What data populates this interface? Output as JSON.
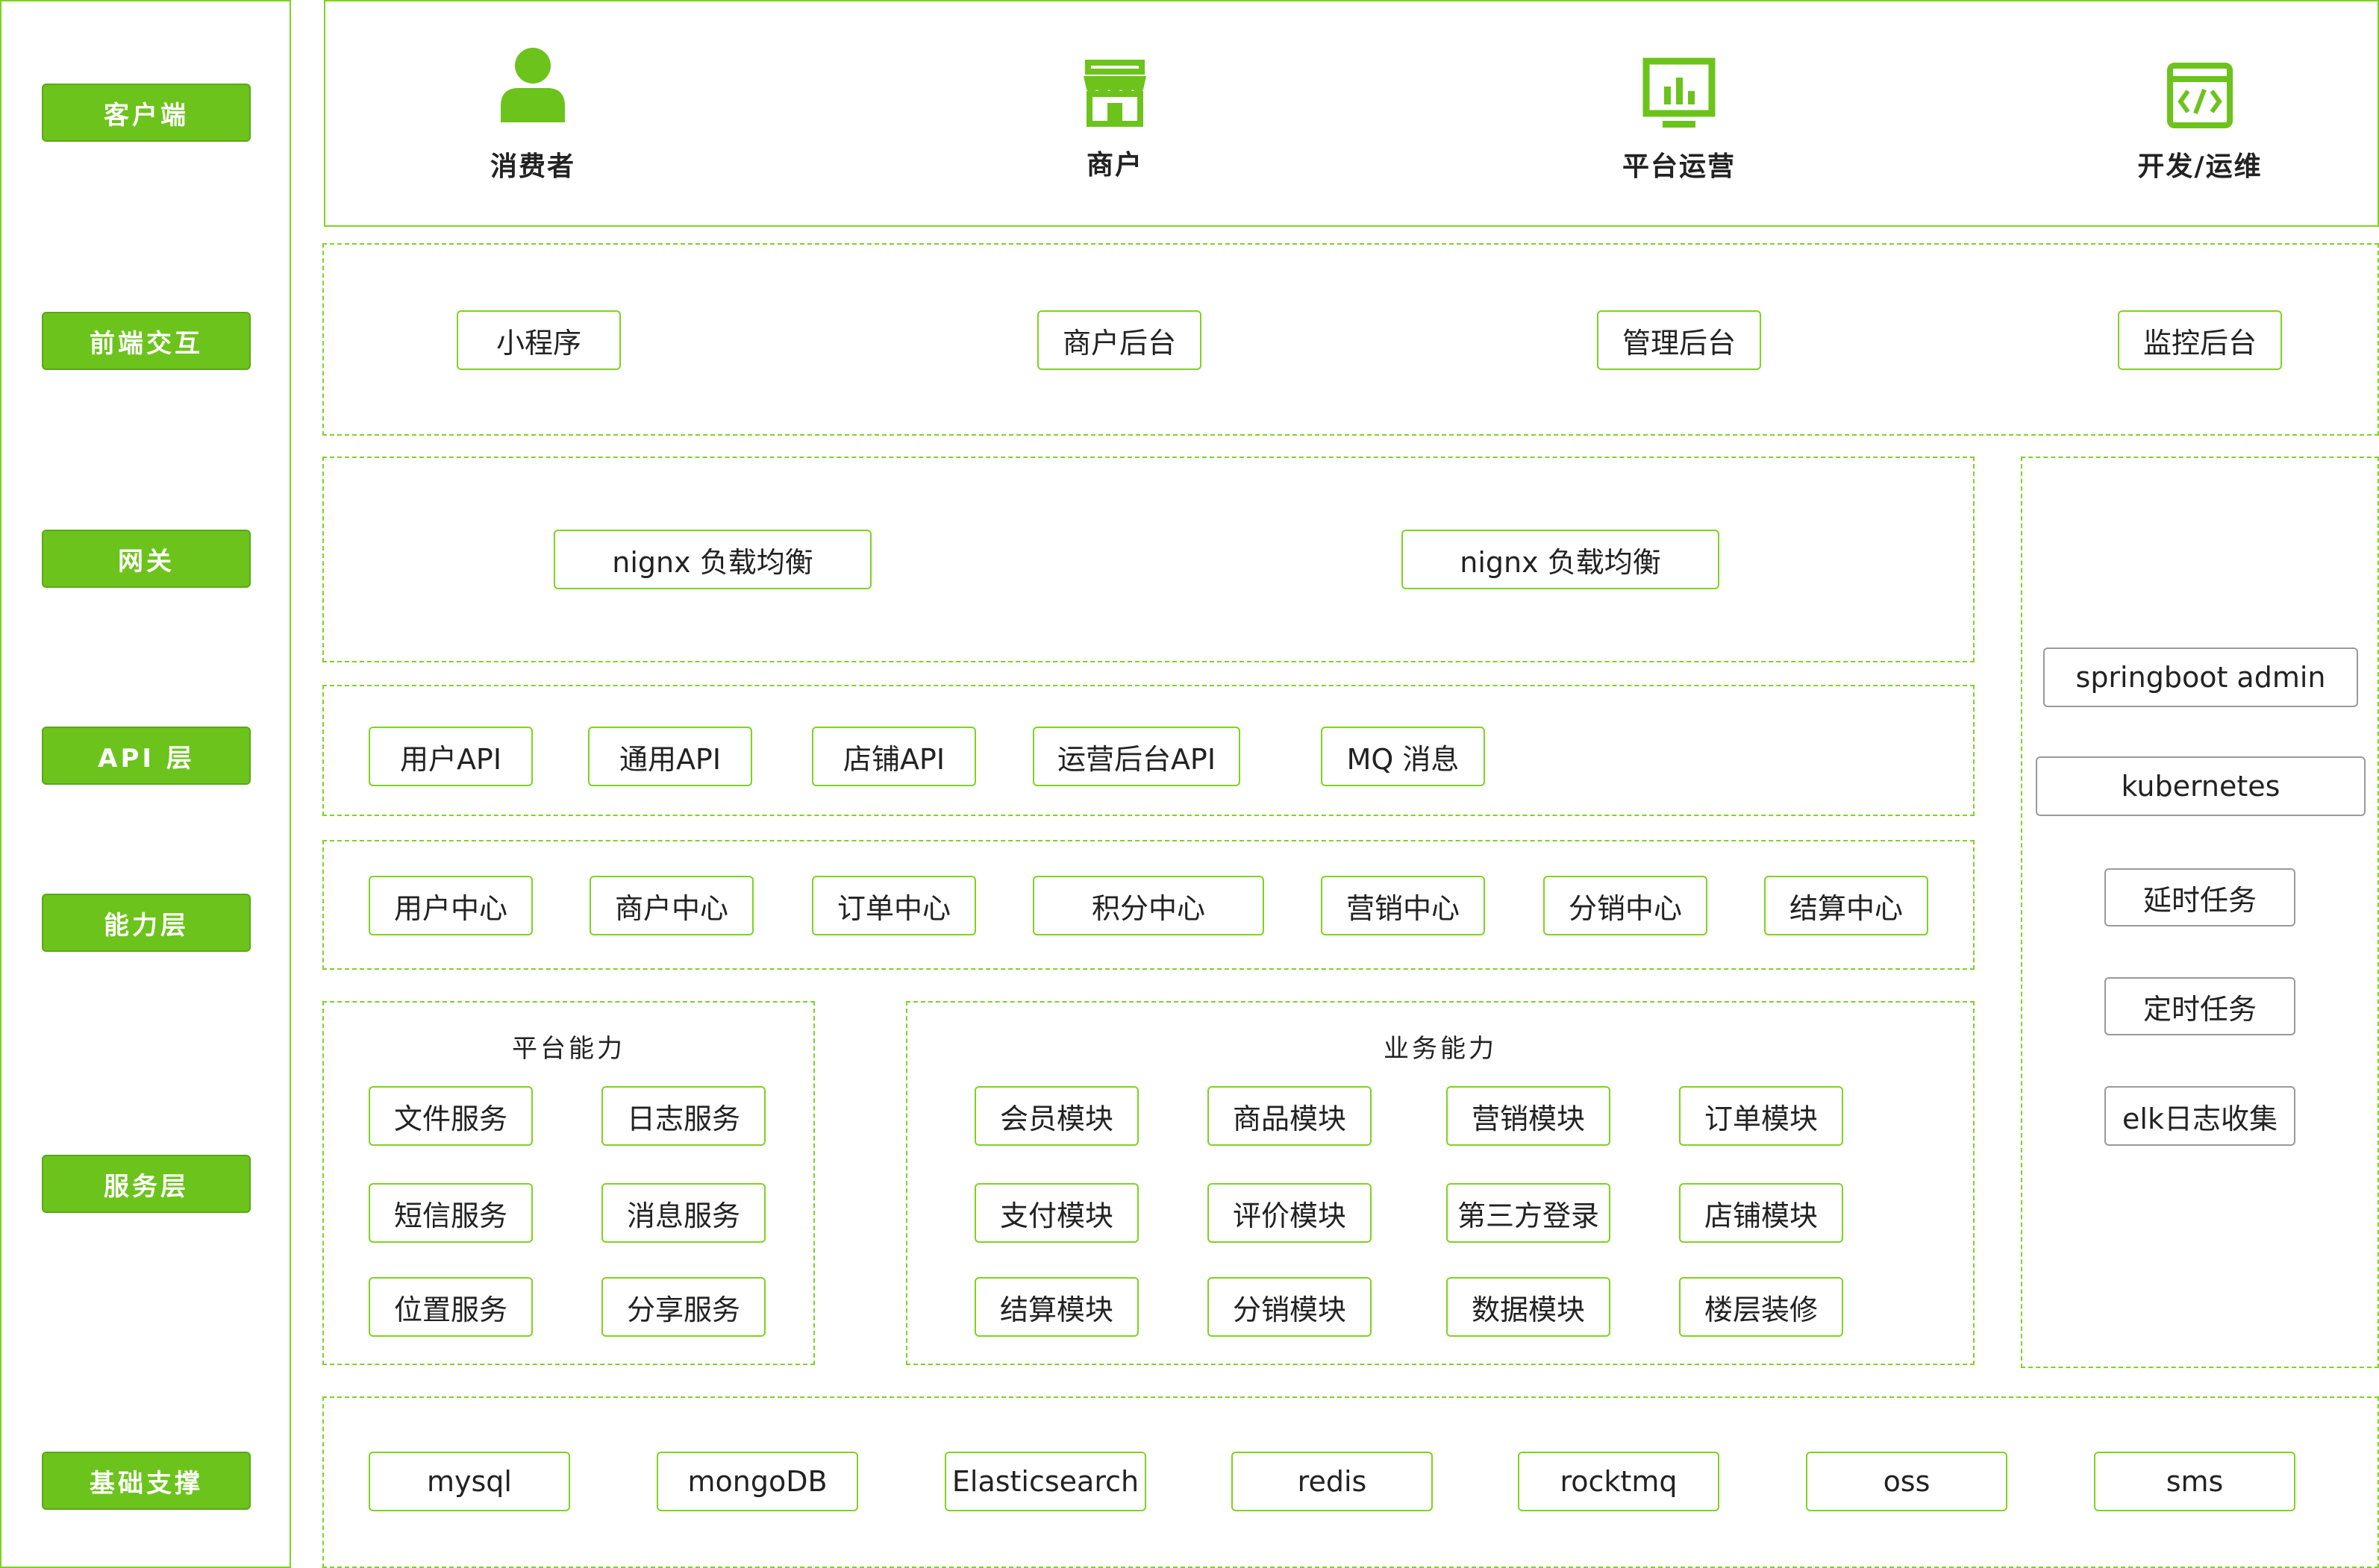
{
  "colors": {
    "accent": "#6cc31c",
    "border": "#7ed321",
    "gray_border": "#9a9a9a"
  },
  "layers": [
    "客户端",
    "前端交互",
    "网关",
    "API 层",
    "能力层",
    "服务层",
    "基础支撑"
  ],
  "clients": [
    {
      "label": "消费者",
      "icon": "user-icon"
    },
    {
      "label": "商户",
      "icon": "store-icon"
    },
    {
      "label": "平台运营",
      "icon": "chart-monitor-icon"
    },
    {
      "label": "开发/运维",
      "icon": "code-window-icon"
    }
  ],
  "frontend": [
    "小程序",
    "商户后台",
    "管理后台",
    "监控后台"
  ],
  "gateway": [
    "nignx 负载均衡",
    "nignx 负载均衡"
  ],
  "api": [
    "用户API",
    "通用API",
    "店铺API",
    "运营后台API",
    "MQ 消息"
  ],
  "capability": [
    "用户中心",
    "商户中心",
    "订单中心",
    "积分中心",
    "营销中心",
    "分销中心",
    "结算中心"
  ],
  "platform": {
    "title": "平台能力",
    "items": [
      "文件服务",
      "日志服务",
      "短信服务",
      "消息服务",
      "位置服务",
      "分享服务"
    ]
  },
  "business": {
    "title": "业务能力",
    "items": [
      "会员模块",
      "商品模块",
      "营销模块",
      "订单模块",
      "支付模块",
      "评价模块",
      "第三方登录",
      "店铺模块",
      "结算模块",
      "分销模块",
      "数据模块",
      "楼层装修"
    ]
  },
  "ops": [
    "springboot admin",
    "kubernetes",
    "延时任务",
    "定时任务",
    "elk日志收集"
  ],
  "infra": [
    "mysql",
    "mongoDB",
    "Elasticsearch",
    "redis",
    "rocktmq",
    "oss",
    "sms"
  ]
}
